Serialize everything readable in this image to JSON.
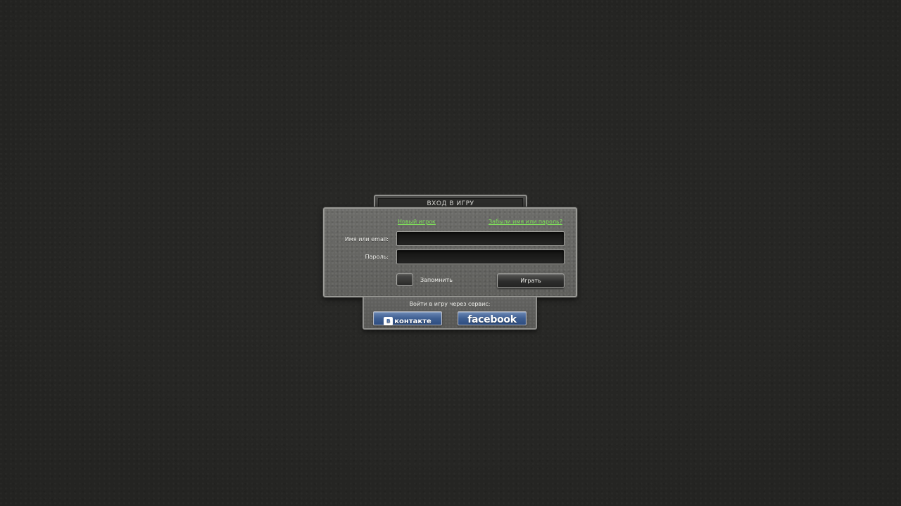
{
  "login": {
    "title": "ВХОД В ИГРУ",
    "new_player_link": "Новый игрок",
    "forgot_link": "Забыли имя или пароль?",
    "name_label": "Имя или email:",
    "name_value": "",
    "password_label": "Пароль:",
    "password_value": "",
    "remember_label": "Запомнить",
    "play_button": "Играть"
  },
  "social": {
    "caption": "Войти в игру через сервис:",
    "vk_mark": "В",
    "vk_label": "контакте",
    "facebook_label": "facebook"
  },
  "colors": {
    "link": "#7fe15a",
    "social_button": "#3f5f92"
  },
  "icons": {
    "vk": "vkontakte-logo-icon",
    "facebook": "facebook-logo-icon"
  }
}
